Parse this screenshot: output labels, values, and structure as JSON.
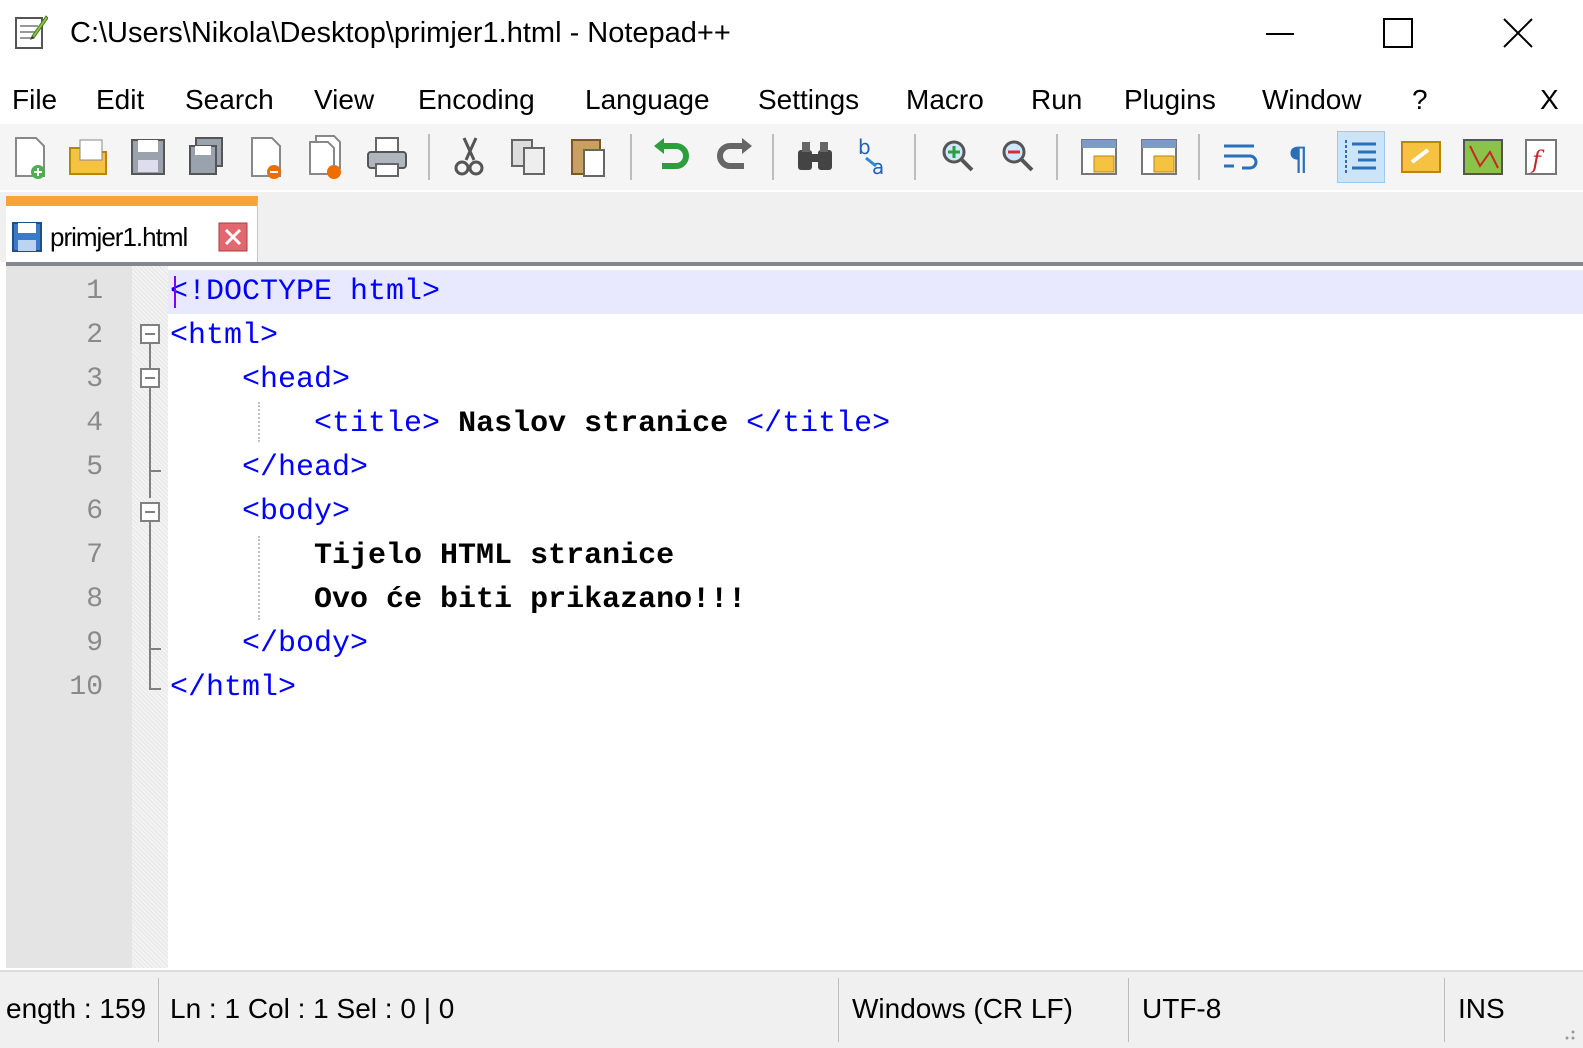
{
  "window": {
    "title": "C:\\Users\\Nikola\\Desktop\\primjer1.html - Notepad++",
    "app_icon": "notepad-plus-plus-icon",
    "controls": [
      "minimize-icon",
      "maximize-icon",
      "close-icon"
    ]
  },
  "menu": {
    "items": [
      "File",
      "Edit",
      "Search",
      "View",
      "Encoding",
      "Language",
      "Settings",
      "Macro",
      "Run",
      "Plugins",
      "Window",
      "?"
    ],
    "close_doc": "X"
  },
  "toolbar": {
    "buttons": [
      "new-file-icon",
      "open-file-icon",
      "save-icon",
      "save-all-icon",
      "close-icon",
      "close-all-icon",
      "print-icon",
      "cut-icon",
      "copy-icon",
      "paste-icon",
      "undo-icon",
      "redo-icon",
      "find-icon",
      "replace-icon",
      "zoom-in-icon",
      "zoom-out-icon",
      "sync-vertical-icon",
      "sync-horizontal-icon",
      "word-wrap-icon",
      "show-all-chars-icon",
      "indent-guide-icon",
      "udl-icon",
      "doc-map-icon",
      "function-list-icon"
    ],
    "active": "indent-guide-icon"
  },
  "tabs": [
    {
      "label": "primjer1.html",
      "active": true,
      "accent": "#f7a336"
    }
  ],
  "editor": {
    "line_numbers": [
      "1",
      "2",
      "3",
      "4",
      "5",
      "6",
      "7",
      "8",
      "9",
      "10"
    ],
    "lines": [
      [
        {
          "t": "<!DOCTYPE html>",
          "c": "tag"
        }
      ],
      [
        {
          "t": "<html>",
          "c": "tag"
        }
      ],
      [
        {
          "t": "    "
        },
        {
          "t": "<head>",
          "c": "tag"
        }
      ],
      [
        {
          "t": "        "
        },
        {
          "t": "<title>",
          "c": "tag"
        },
        {
          "t": " Naslov stranice ",
          "c": "txt"
        },
        {
          "t": "</title>",
          "c": "tag"
        }
      ],
      [
        {
          "t": "    "
        },
        {
          "t": "</head>",
          "c": "tag"
        }
      ],
      [
        {
          "t": "    "
        },
        {
          "t": "<body>",
          "c": "tag"
        }
      ],
      [
        {
          "t": "        "
        },
        {
          "t": "Tijelo HTML stranice",
          "c": "txt"
        }
      ],
      [
        {
          "t": "        "
        },
        {
          "t": "Ovo će biti prikazano!!!",
          "c": "txt"
        }
      ],
      [
        {
          "t": "    "
        },
        {
          "t": "</body>",
          "c": "tag"
        }
      ],
      [
        {
          "t": "</html>",
          "c": "tag"
        }
      ]
    ],
    "colors": {
      "tag": "#0000ff",
      "text": "#000000",
      "current_line": "#e8e8ff",
      "line_number": "#8a8a8a"
    }
  },
  "status": {
    "length": "ength : 159",
    "position": "Ln : 1    Col : 1    Sel : 0 | 0",
    "eol": "Windows (CR LF)",
    "encoding": "UTF-8",
    "mode": "INS"
  }
}
